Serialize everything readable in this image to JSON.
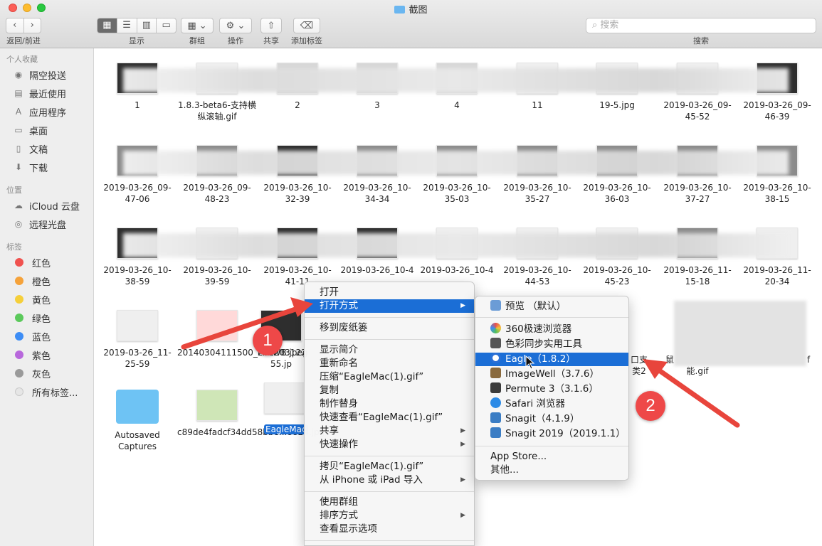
{
  "window": {
    "title": "截图"
  },
  "toolbar": {
    "nav_label": "返回/前进",
    "view_label": "显示",
    "group_label": "群组",
    "action_label": "操作",
    "share_label": "共享",
    "tag_label": "添加标签",
    "search_label": "搜索",
    "search_placeholder": "搜索"
  },
  "sidebar": {
    "favorites_heading": "个人收藏",
    "favorites": [
      {
        "label": "隔空投送",
        "icon": "airdrop-icon"
      },
      {
        "label": "最近使用",
        "icon": "recents-icon"
      },
      {
        "label": "应用程序",
        "icon": "applications-icon"
      },
      {
        "label": "桌面",
        "icon": "desktop-icon"
      },
      {
        "label": "文稿",
        "icon": "documents-icon"
      },
      {
        "label": "下载",
        "icon": "downloads-icon"
      }
    ],
    "locations_heading": "位置",
    "locations": [
      {
        "label": "iCloud 云盘",
        "icon": "icloud-icon"
      },
      {
        "label": "远程光盘",
        "icon": "remote-disc-icon"
      }
    ],
    "tags_heading": "标签",
    "tags": [
      {
        "label": "红色",
        "color": "#f0524f"
      },
      {
        "label": "橙色",
        "color": "#f5a23a"
      },
      {
        "label": "黄色",
        "color": "#f5cf3a"
      },
      {
        "label": "绿色",
        "color": "#5bc95b"
      },
      {
        "label": "蓝色",
        "color": "#3d8df5"
      },
      {
        "label": "紫色",
        "color": "#b868dc"
      },
      {
        "label": "灰色",
        "color": "#9a9a9a"
      },
      {
        "label": "所有标签...",
        "color": "#e6e6e6"
      }
    ]
  },
  "files": {
    "row1": [
      "1",
      "1.8.3-beta6-支持横纵滚轴.gif",
      "2",
      "3",
      "4",
      "11",
      "19-5.jpg",
      "2019-03-26_09-45-52",
      "2019-03-26_09-46-39"
    ],
    "row2": [
      "2019-03-26_09-47-06",
      "2019-03-26_09-48-23",
      "2019-03-26_10-32-39",
      "2019-03-26_10-34-34",
      "2019-03-26_10-35-03",
      "2019-03-26_10-35-27",
      "2019-03-26_10-36-03",
      "2019-03-26_10-37-27",
      "2019-03-26_10-38-15"
    ],
    "row3": [
      "2019-03-26_10-38-59",
      "2019-03-26_10-39-59",
      "2019-03-26_10-41-11",
      "2019-03-26_10-4",
      "2019-03-26_10-4",
      "2019-03-26_10-44-53",
      "2019-03-26_10-45-23",
      "2019-03-26_11-15-18",
      "2019-03-26_11-20-34"
    ],
    "row4": [
      "2019-03-26_11-25-59",
      "20140304111500_FFkWB.jpeg",
      "201203122 55.jp",
      "口支 类2",
      "鼠",
      "能.gif",
      "f"
    ],
    "row5": [
      "Autosaved Captures",
      "c89de4fadcf34dd58bbe...8824.jpg",
      "EagleMac"
    ]
  },
  "context_menu": {
    "items": [
      "打开",
      "打开方式",
      "移到废纸篓",
      "显示简介",
      "重新命名",
      "压缩“EagleMac(1).gif”",
      "复制",
      "制作替身",
      "快速查看“EagleMac(1).gif”",
      "共享",
      "快速操作",
      "拷贝“EagleMac(1).gif”",
      "从 iPhone 或 iPad 导入",
      "使用群组",
      "排序方式",
      "查看显示选项"
    ]
  },
  "open_with_menu": {
    "default": "预览 （默认）",
    "apps": [
      {
        "label": "360极速浏览器",
        "color": "#3aa34b"
      },
      {
        "label": "色彩同步实用工具",
        "color": "#555555"
      },
      {
        "label": "Eagle（1.8.2）",
        "color": "#2a6fd6"
      },
      {
        "label": "ImageWell（3.7.6）",
        "color": "#8a6a3d"
      },
      {
        "label": "Permute 3（3.1.6）",
        "color": "#3c3c3c"
      },
      {
        "label": "Safari 浏览器",
        "color": "#2d8be6"
      },
      {
        "label": "Snagit（4.1.9）",
        "color": "#3b7dc4"
      },
      {
        "label": "Snagit 2019（2019.1.1）",
        "color": "#3b7dc4"
      }
    ],
    "app_store": "App Store...",
    "other": "其他..."
  },
  "annotations": {
    "badge1": "1",
    "badge2": "2"
  }
}
